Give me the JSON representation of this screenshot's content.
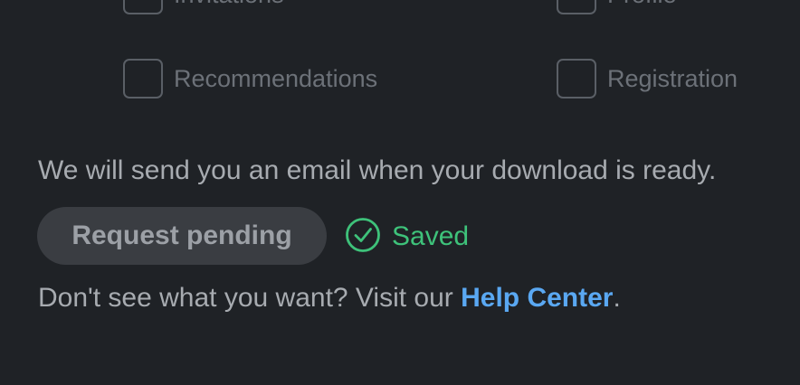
{
  "categories": [
    {
      "label": "Invitations",
      "checked": false
    },
    {
      "label": "Profile",
      "checked": false
    },
    {
      "label": "Recommendations",
      "checked": false
    },
    {
      "label": "Registration",
      "checked": false
    }
  ],
  "notice": {
    "text": "We will send you an email when your download is ready."
  },
  "request_button": {
    "label": "Request pending"
  },
  "status": {
    "label": "Saved",
    "icon": "check-circle-icon",
    "color": "#3ec27a"
  },
  "help": {
    "prefix": "Don't see what you want? Visit our ",
    "link_text": "Help Center",
    "suffix": ".",
    "link_color": "#5aa8f2"
  },
  "colors": {
    "background": "#1f2226",
    "button_background": "#3a3d42"
  }
}
